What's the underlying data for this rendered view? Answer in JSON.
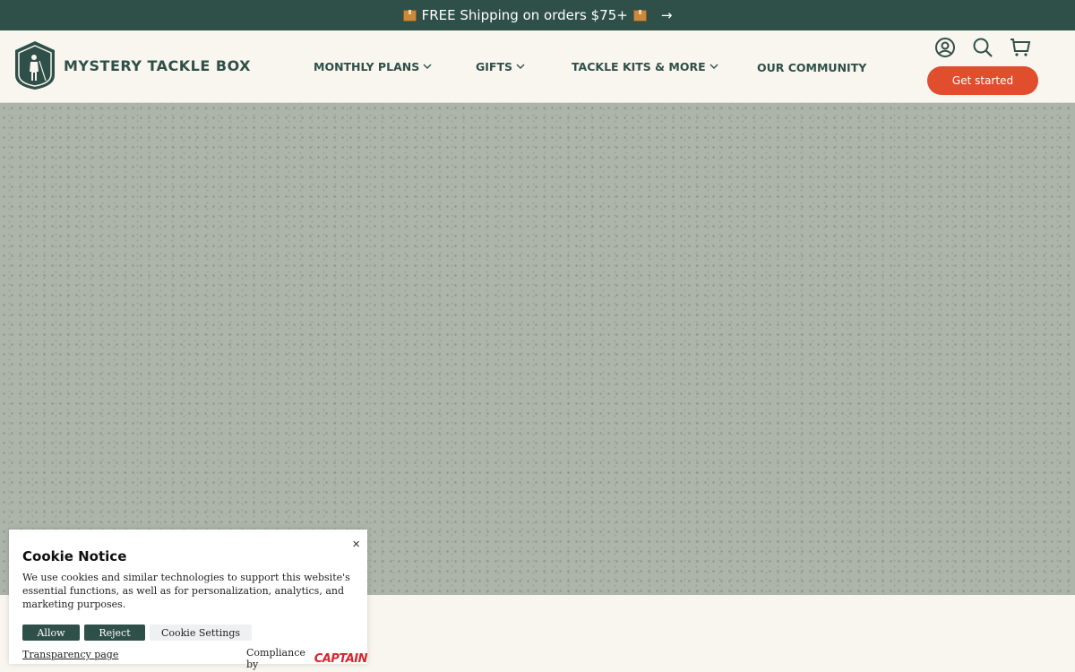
{
  "announcement": {
    "text": "FREE Shipping on orders $75+",
    "icon": "package-icon",
    "arrow": "→"
  },
  "header": {
    "logo_text": "MYSTERY TACKLE BOX",
    "nav": [
      {
        "label": "MONTHLY PLANS",
        "has_dropdown": true
      },
      {
        "label": "GIFTS",
        "has_dropdown": true
      },
      {
        "label": "TACKLE KITS & MORE",
        "has_dropdown": true
      },
      {
        "label": "OUR COMMUNITY",
        "has_dropdown": false
      }
    ],
    "icons": [
      "account-icon",
      "search-icon",
      "cart-icon"
    ],
    "cta_label": "Get started"
  },
  "colors": {
    "brand_green": "#2f5049",
    "cta_red": "#e04e2e",
    "page_bg": "#f9f5ef",
    "hero_bg": "#adb5aa"
  },
  "cookie_notice": {
    "title": "Cookie Notice",
    "body": "We use cookies and similar technologies to support this website's essential functions, as well as for personalization, analytics, and marketing purposes.",
    "allow_label": "Allow",
    "reject_label": "Reject",
    "settings_label": "Cookie Settings",
    "transparency_label": "Transparency page",
    "compliance_label": "Compliance by",
    "compliance_brand": "CAPTAIN",
    "close_label": "×"
  }
}
